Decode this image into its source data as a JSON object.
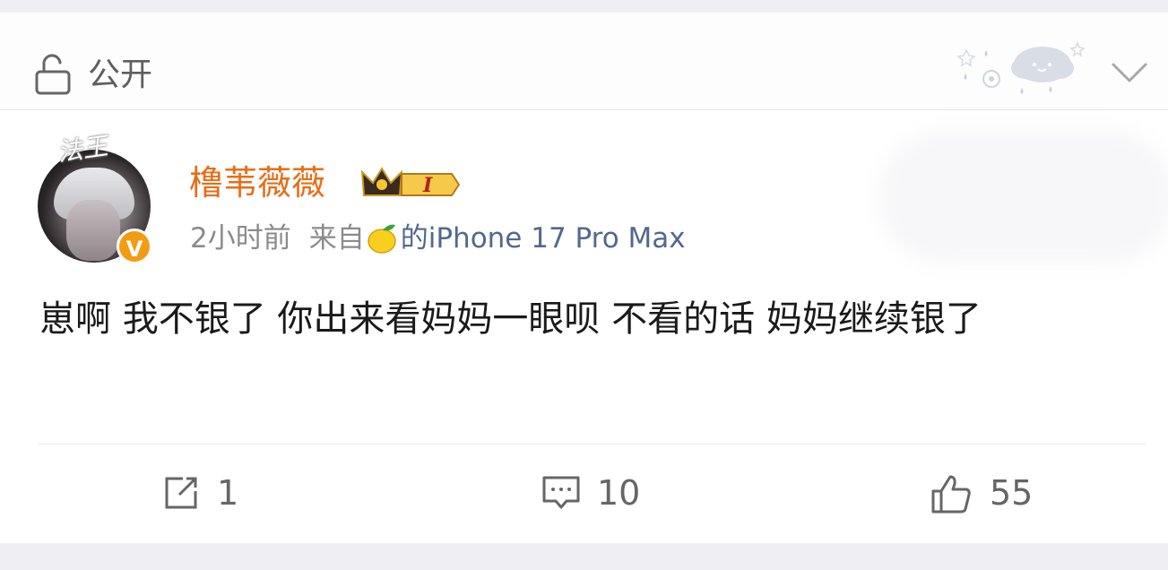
{
  "privacy": {
    "label": "公开",
    "icon": "lock-open-icon"
  },
  "post": {
    "author": "橹苇薇薇",
    "avatar_tag": "法王",
    "verified_badge": "V",
    "member_badge_level": "I",
    "time": "2小时前",
    "from_label": "来自",
    "source_prefix": "的",
    "device": "iPhone 17 Pro Max",
    "text": "崽啊 我不银了 你出来看妈妈一眼呗 不看的话 妈妈继续银了"
  },
  "actions": {
    "repost_count": "1",
    "comment_count": "10",
    "like_count": "55"
  },
  "colors": {
    "username": "#e86d14",
    "device": "#52698c",
    "badge": "#f39c13"
  }
}
